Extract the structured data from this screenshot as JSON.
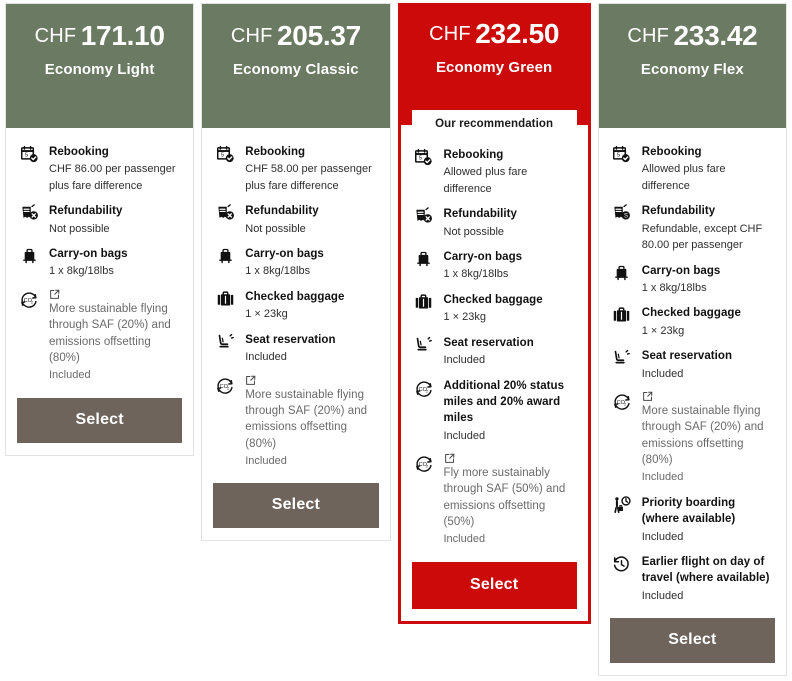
{
  "accent_colors": {
    "standard_header": "#6b7a62",
    "recommended_header": "#cc0a0a",
    "standard_button": "#6e645c",
    "recommended_button": "#cc0a0a",
    "card_border": "#e2e2e2",
    "muted_text": "#6a6a6a"
  },
  "cards": [
    {
      "currency": "CHF",
      "price": "171.10",
      "name": "Economy Light",
      "recommended": false,
      "badge": null,
      "select_label": "Select",
      "features": [
        {
          "icon": "calendar-rebooking-icon",
          "title": "Rebooking",
          "value": "CHF 86.00 per passenger plus fare difference",
          "muted": false,
          "external_link": false
        },
        {
          "icon": "receipt-refund-blocked-icon",
          "title": "Refundability",
          "value": "Not possible",
          "muted": false,
          "external_link": false
        },
        {
          "icon": "carry-on-bag-icon",
          "title": "Carry-on bags",
          "value": "1 x 8kg/18lbs",
          "muted": false,
          "external_link": false
        },
        {
          "icon": "co2-cycle-icon",
          "title": "More sustainable flying through SAF (20%) and emissions offsetting (80%)",
          "value": "Included",
          "muted": true,
          "external_link": true
        }
      ]
    },
    {
      "currency": "CHF",
      "price": "205.37",
      "name": "Economy Classic",
      "recommended": false,
      "badge": null,
      "select_label": "Select",
      "features": [
        {
          "icon": "calendar-rebooking-icon",
          "title": "Rebooking",
          "value": "CHF 58.00 per passenger plus fare difference",
          "muted": false,
          "external_link": false
        },
        {
          "icon": "receipt-refund-blocked-icon",
          "title": "Refundability",
          "value": "Not possible",
          "muted": false,
          "external_link": false
        },
        {
          "icon": "carry-on-bag-icon",
          "title": "Carry-on bags",
          "value": "1 x 8kg/18lbs",
          "muted": false,
          "external_link": false
        },
        {
          "icon": "checked-baggage-icon",
          "title": "Checked baggage",
          "value": "1 × 23kg",
          "muted": false,
          "external_link": false
        },
        {
          "icon": "seat-reservation-icon",
          "title": "Seat reservation",
          "value": "Included",
          "muted": false,
          "external_link": false
        },
        {
          "icon": "co2-cycle-icon",
          "title": "More sustainable flying through SAF (20%) and emissions offsetting (80%)",
          "value": "Included",
          "muted": true,
          "external_link": true
        }
      ]
    },
    {
      "currency": "CHF",
      "price": "232.50",
      "name": "Economy Green",
      "recommended": true,
      "badge": "Our recommendation",
      "select_label": "Select",
      "features": [
        {
          "icon": "calendar-rebooking-icon",
          "title": "Rebooking",
          "value": "Allowed plus fare difference",
          "muted": false,
          "external_link": false
        },
        {
          "icon": "receipt-refund-blocked-icon",
          "title": "Refundability",
          "value": "Not possible",
          "muted": false,
          "external_link": false
        },
        {
          "icon": "carry-on-bag-icon",
          "title": "Carry-on bags",
          "value": "1 x 8kg/18lbs",
          "muted": false,
          "external_link": false
        },
        {
          "icon": "checked-baggage-icon",
          "title": "Checked baggage",
          "value": "1 × 23kg",
          "muted": false,
          "external_link": false
        },
        {
          "icon": "seat-reservation-icon",
          "title": "Seat reservation",
          "value": "Included",
          "muted": false,
          "external_link": false
        },
        {
          "icon": "co2-cycle-icon",
          "title": "Additional 20% status miles and 20% award miles",
          "value": "Included",
          "muted": false,
          "external_link": false
        },
        {
          "icon": "co2-cycle-icon",
          "title": "Fly more sustainably through SAF (50%) and emissions offsetting (50%)",
          "value": "Included",
          "muted": true,
          "external_link": true
        }
      ]
    },
    {
      "currency": "CHF",
      "price": "233.42",
      "name": "Economy Flex",
      "recommended": false,
      "badge": null,
      "select_label": "Select",
      "features": [
        {
          "icon": "calendar-rebooking-icon",
          "title": "Rebooking",
          "value": "Allowed plus fare difference",
          "muted": false,
          "external_link": false
        },
        {
          "icon": "receipt-refund-icon",
          "title": "Refundability",
          "value": "Refundable, except CHF 80.00 per passenger",
          "muted": false,
          "external_link": false
        },
        {
          "icon": "carry-on-bag-icon",
          "title": "Carry-on bags",
          "value": "1 x 8kg/18lbs",
          "muted": false,
          "external_link": false
        },
        {
          "icon": "checked-baggage-icon",
          "title": "Checked baggage",
          "value": "1 × 23kg",
          "muted": false,
          "external_link": false
        },
        {
          "icon": "seat-reservation-icon",
          "title": "Seat reservation",
          "value": "Included",
          "muted": false,
          "external_link": false
        },
        {
          "icon": "co2-cycle-icon",
          "title": "More sustainable flying through SAF (20%) and emissions offsetting (80%)",
          "value": "Included",
          "muted": true,
          "external_link": true
        },
        {
          "icon": "priority-boarding-icon",
          "title": "Priority boarding (where available)",
          "value": "Included",
          "muted": false,
          "external_link": false
        },
        {
          "icon": "earlier-flight-clock-icon",
          "title": "Earlier flight on day of travel (where available)",
          "value": "Included",
          "muted": false,
          "external_link": false
        }
      ]
    }
  ]
}
